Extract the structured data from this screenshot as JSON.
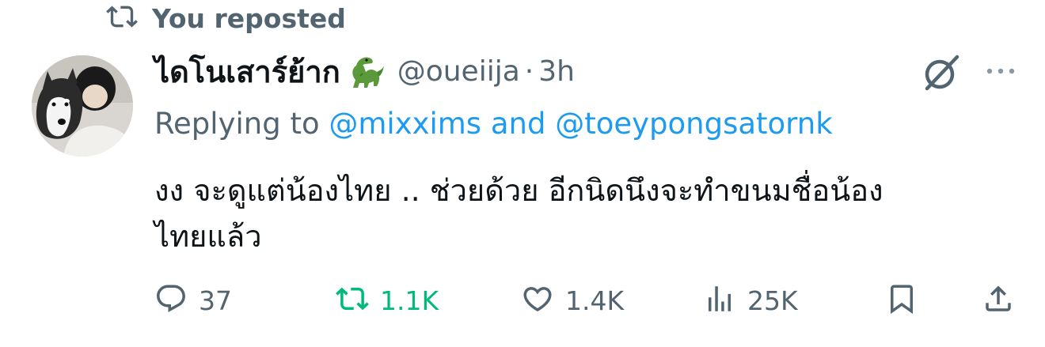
{
  "repost_banner": {
    "icon": "repost-icon",
    "text": "You reposted"
  },
  "author": {
    "display_name": "ไดโนเสาร์ย้าก",
    "name_emoji": "dinosaur-emoji",
    "handle": "@oueiija",
    "separator": "·",
    "time": "3h"
  },
  "reply_context": {
    "prefix": "Replying to ",
    "mention_1": "@mixxims",
    "joiner": " and ",
    "mention_2": "@toeypongsatornk"
  },
  "tweet": {
    "line_1": "งง จะดูแต่น้องไทย .. ช่วยด้วย อีกนิดนึงจะทำขนมชื่อน้อง",
    "line_2": "ไทยแล้ว"
  },
  "actions": {
    "replies": "37",
    "reposts": "1.1K",
    "likes": "1.4K",
    "views": "25K"
  },
  "colors": {
    "text_primary": "#0f1419",
    "text_secondary": "#536471",
    "link": "#1d9bf0",
    "repost_active": "#00ba7c"
  }
}
